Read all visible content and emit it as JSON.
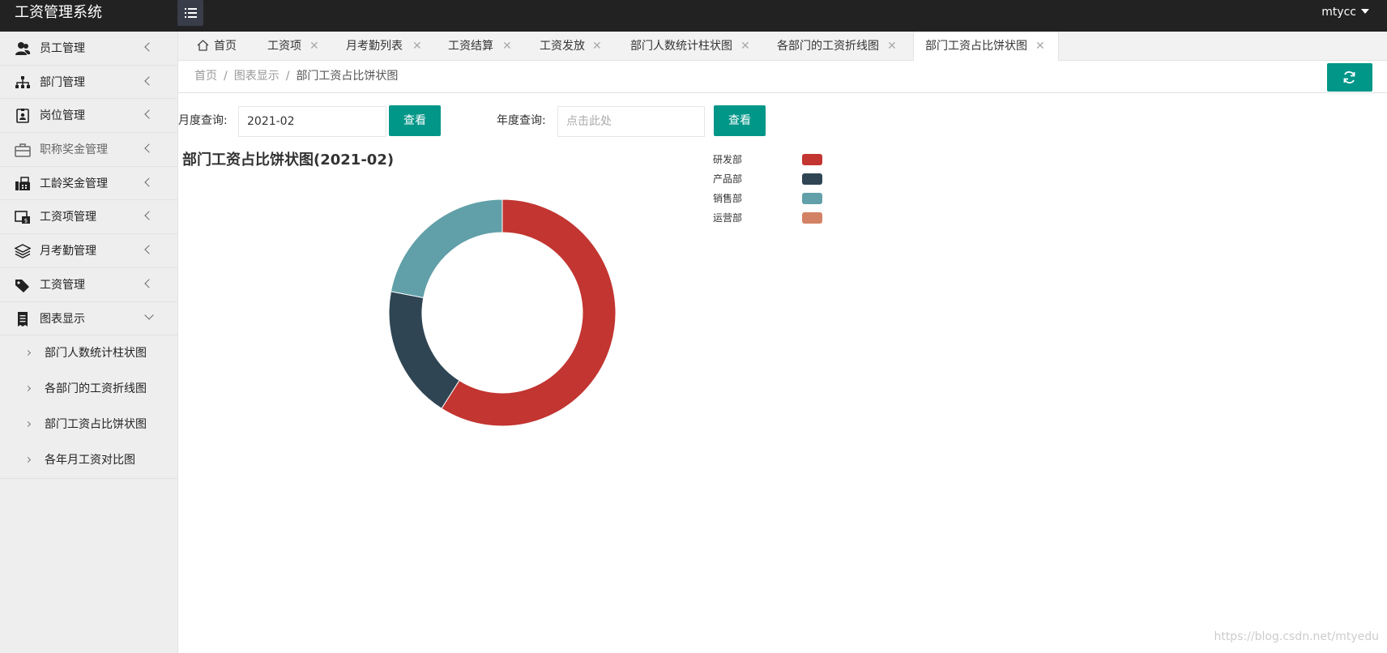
{
  "header": {
    "app_title": "工资管理系统",
    "username": "mtycc"
  },
  "sidebar": {
    "items": [
      {
        "label": "员工管理",
        "icon": "users-icon"
      },
      {
        "label": "部门管理",
        "icon": "sitemap-icon"
      },
      {
        "label": "岗位管理",
        "icon": "id-badge-icon"
      },
      {
        "label": "职称奖金管理",
        "icon": "briefcase-icon"
      },
      {
        "label": "工龄奖金管理",
        "icon": "fax-icon"
      },
      {
        "label": "工资项管理",
        "icon": "money-list-icon"
      },
      {
        "label": "月考勤管理",
        "icon": "layers-icon"
      },
      {
        "label": "工资管理",
        "icon": "tags-icon"
      },
      {
        "label": "图表显示",
        "icon": "receipt-icon"
      }
    ],
    "sub_items": [
      {
        "label": "部门人数统计柱状图"
      },
      {
        "label": "各部门的工资折线图"
      },
      {
        "label": "部门工资占比饼状图"
      },
      {
        "label": "各年月工资对比图"
      }
    ]
  },
  "tabs": [
    {
      "label": "首页"
    },
    {
      "label": "工资项"
    },
    {
      "label": "月考勤列表"
    },
    {
      "label": "工资结算"
    },
    {
      "label": "工资发放"
    },
    {
      "label": "部门人数统计柱状图"
    },
    {
      "label": "各部门的工资折线图"
    },
    {
      "label": "部门工资占比饼状图"
    }
  ],
  "tab_close_glyph": "✕",
  "breadcrumb": {
    "items": [
      "首页",
      "图表显示",
      "部门工资占比饼状图"
    ],
    "separator": "/"
  },
  "query": {
    "month_label": "月度查询:",
    "month_value": "2021-02",
    "year_label": "年度查询:",
    "year_placeholder": "点击此处",
    "view_button": "查看"
  },
  "colors": {
    "accent": "#009688",
    "header_bg": "#222222"
  },
  "chart_data": {
    "type": "pie",
    "variant": "donut",
    "title": "部门工资占比饼状图(2021-02)",
    "legend_position": "top-right",
    "series": [
      {
        "name": "研发部",
        "value": 59,
        "color": "#c23531"
      },
      {
        "name": "产品部",
        "value": 19,
        "color": "#2f4554"
      },
      {
        "name": "销售部",
        "value": 22,
        "color": "#61a0a8"
      },
      {
        "name": "运营部",
        "value": 0,
        "color": "#d48265"
      }
    ]
  },
  "watermark": "https://blog.csdn.net/mtyedu"
}
